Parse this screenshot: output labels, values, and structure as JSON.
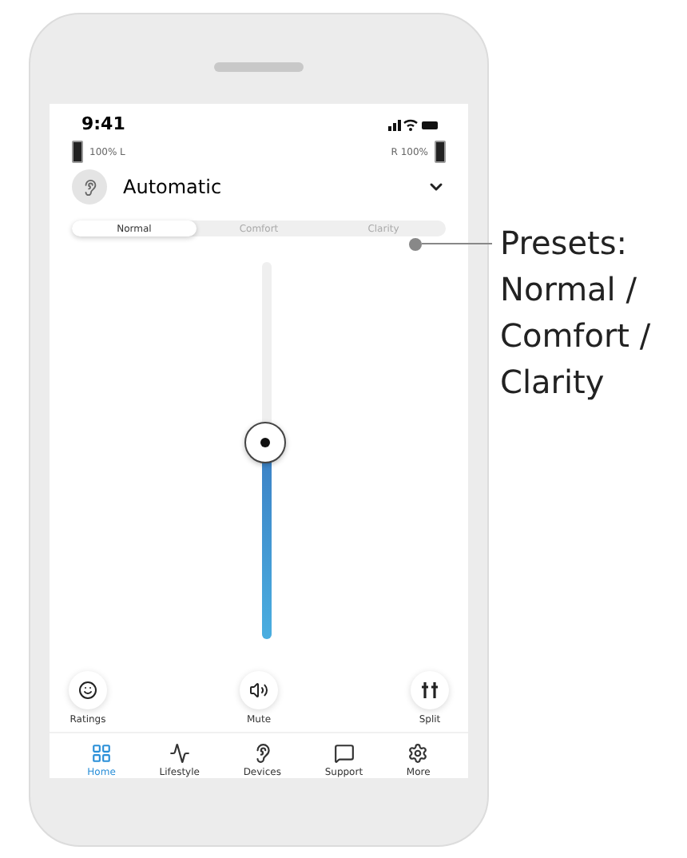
{
  "status_bar": {
    "time": "9:41"
  },
  "batteries": {
    "left": "100% L",
    "right": "R 100%"
  },
  "program": {
    "name": "Automatic"
  },
  "presets": [
    {
      "label": "Normal",
      "selected": true
    },
    {
      "label": "Comfort",
      "selected": false
    },
    {
      "label": "Clarity",
      "selected": false
    }
  ],
  "volume": {
    "level": 0.52
  },
  "actions": [
    {
      "label": "Ratings",
      "kind": "smile"
    },
    {
      "label": "Mute",
      "kind": "speaker"
    },
    {
      "label": "Split",
      "kind": "split"
    }
  ],
  "nav": [
    {
      "label": "Home",
      "kind": "home",
      "selected": true
    },
    {
      "label": "Lifestyle",
      "kind": "pulse",
      "selected": false
    },
    {
      "label": "Devices",
      "kind": "ear",
      "selected": false
    },
    {
      "label": "Support",
      "kind": "chat",
      "selected": false
    },
    {
      "label": "More",
      "kind": "gear",
      "selected": false
    }
  ],
  "annotation": {
    "lines": [
      "Presets:",
      "Normal /",
      "Comfort /",
      "Clarity"
    ]
  }
}
